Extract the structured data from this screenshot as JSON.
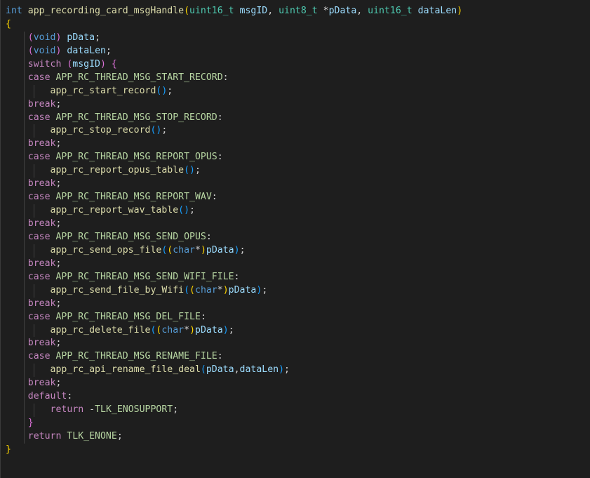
{
  "editor": {
    "language": "c",
    "lines": [
      {
        "indent": 0,
        "tokens": [
          {
            "c": "keyword",
            "t": "int "
          },
          {
            "c": "func",
            "t": "app_recording_card_msgHandle"
          },
          {
            "c": "brace",
            "t": "("
          },
          {
            "c": "type",
            "t": "uint16_t "
          },
          {
            "c": "param",
            "t": "msgID"
          },
          {
            "c": "plain",
            "t": ", "
          },
          {
            "c": "type",
            "t": "uint8_t "
          },
          {
            "c": "plain",
            "t": "*"
          },
          {
            "c": "param",
            "t": "pData"
          },
          {
            "c": "plain",
            "t": ", "
          },
          {
            "c": "type",
            "t": "uint16_t "
          },
          {
            "c": "param",
            "t": "dataLen"
          },
          {
            "c": "brace",
            "t": ")"
          }
        ]
      },
      {
        "indent": 0,
        "tokens": [
          {
            "c": "brace",
            "t": "{"
          }
        ]
      },
      {
        "indent": 1,
        "tokens": [
          {
            "c": "brace2",
            "t": "("
          },
          {
            "c": "keyword",
            "t": "void"
          },
          {
            "c": "brace2",
            "t": ")"
          },
          {
            "c": "plain",
            "t": " "
          },
          {
            "c": "param",
            "t": "pData"
          },
          {
            "c": "plain",
            "t": ";"
          }
        ]
      },
      {
        "indent": 1,
        "tokens": [
          {
            "c": "brace2",
            "t": "("
          },
          {
            "c": "keyword",
            "t": "void"
          },
          {
            "c": "brace2",
            "t": ")"
          },
          {
            "c": "plain",
            "t": " "
          },
          {
            "c": "param",
            "t": "dataLen"
          },
          {
            "c": "plain",
            "t": ";"
          }
        ]
      },
      {
        "indent": 1,
        "tokens": [
          {
            "c": "ctrl",
            "t": "switch "
          },
          {
            "c": "brace2",
            "t": "("
          },
          {
            "c": "param",
            "t": "msgID"
          },
          {
            "c": "brace2",
            "t": ")"
          },
          {
            "c": "plain",
            "t": " "
          },
          {
            "c": "brace2",
            "t": "{"
          }
        ]
      },
      {
        "indent": 1,
        "tokens": [
          {
            "c": "ctrl",
            "t": "case "
          },
          {
            "c": "enumval",
            "t": "APP_RC_THREAD_MSG_START_RECORD"
          },
          {
            "c": "plain",
            "t": ":"
          }
        ]
      },
      {
        "indent": 2,
        "tokens": [
          {
            "c": "func",
            "t": "app_rc_start_record"
          },
          {
            "c": "paren",
            "t": "()"
          },
          {
            "c": "plain",
            "t": ";"
          }
        ]
      },
      {
        "indent": 1,
        "tokens": [
          {
            "c": "ctrl",
            "t": "break"
          },
          {
            "c": "plain",
            "t": ";"
          }
        ]
      },
      {
        "indent": 1,
        "tokens": [
          {
            "c": "ctrl",
            "t": "case "
          },
          {
            "c": "enumval",
            "t": "APP_RC_THREAD_MSG_STOP_RECORD"
          },
          {
            "c": "plain",
            "t": ":"
          }
        ]
      },
      {
        "indent": 2,
        "tokens": [
          {
            "c": "func",
            "t": "app_rc_stop_record"
          },
          {
            "c": "paren",
            "t": "()"
          },
          {
            "c": "plain",
            "t": ";"
          }
        ]
      },
      {
        "indent": 1,
        "tokens": [
          {
            "c": "ctrl",
            "t": "break"
          },
          {
            "c": "plain",
            "t": ";"
          }
        ]
      },
      {
        "indent": 1,
        "tokens": [
          {
            "c": "ctrl",
            "t": "case "
          },
          {
            "c": "enumval",
            "t": "APP_RC_THREAD_MSG_REPORT_OPUS"
          },
          {
            "c": "plain",
            "t": ":"
          }
        ]
      },
      {
        "indent": 2,
        "tokens": [
          {
            "c": "func",
            "t": "app_rc_report_opus_table"
          },
          {
            "c": "paren",
            "t": "()"
          },
          {
            "c": "plain",
            "t": ";"
          }
        ]
      },
      {
        "indent": 1,
        "tokens": [
          {
            "c": "ctrl",
            "t": "break"
          },
          {
            "c": "plain",
            "t": ";"
          }
        ]
      },
      {
        "indent": 1,
        "tokens": [
          {
            "c": "ctrl",
            "t": "case "
          },
          {
            "c": "enumval",
            "t": "APP_RC_THREAD_MSG_REPORT_WAV"
          },
          {
            "c": "plain",
            "t": ":"
          }
        ]
      },
      {
        "indent": 2,
        "tokens": [
          {
            "c": "func",
            "t": "app_rc_report_wav_table"
          },
          {
            "c": "paren",
            "t": "()"
          },
          {
            "c": "plain",
            "t": ";"
          }
        ]
      },
      {
        "indent": 1,
        "tokens": [
          {
            "c": "ctrl",
            "t": "break"
          },
          {
            "c": "plain",
            "t": ";"
          }
        ]
      },
      {
        "indent": 1,
        "tokens": [
          {
            "c": "ctrl",
            "t": "case "
          },
          {
            "c": "enumval",
            "t": "APP_RC_THREAD_MSG_SEND_OPUS"
          },
          {
            "c": "plain",
            "t": ":"
          }
        ]
      },
      {
        "indent": 2,
        "tokens": [
          {
            "c": "func",
            "t": "app_rc_send_ops_file"
          },
          {
            "c": "paren",
            "t": "("
          },
          {
            "c": "brace",
            "t": "("
          },
          {
            "c": "keyword",
            "t": "char"
          },
          {
            "c": "plain",
            "t": "*"
          },
          {
            "c": "brace",
            "t": ")"
          },
          {
            "c": "param",
            "t": "pData"
          },
          {
            "c": "paren",
            "t": ")"
          },
          {
            "c": "plain",
            "t": ";"
          }
        ]
      },
      {
        "indent": 1,
        "tokens": [
          {
            "c": "ctrl",
            "t": "break"
          },
          {
            "c": "plain",
            "t": ";"
          }
        ]
      },
      {
        "indent": 1,
        "tokens": [
          {
            "c": "ctrl",
            "t": "case "
          },
          {
            "c": "enumval",
            "t": "APP_RC_THREAD_MSG_SEND_WIFI_FILE"
          },
          {
            "c": "plain",
            "t": ":"
          }
        ]
      },
      {
        "indent": 2,
        "tokens": [
          {
            "c": "func",
            "t": "app_rc_send_file_by_Wifi"
          },
          {
            "c": "paren",
            "t": "("
          },
          {
            "c": "brace",
            "t": "("
          },
          {
            "c": "keyword",
            "t": "char"
          },
          {
            "c": "plain",
            "t": "*"
          },
          {
            "c": "brace",
            "t": ")"
          },
          {
            "c": "param",
            "t": "pData"
          },
          {
            "c": "paren",
            "t": ")"
          },
          {
            "c": "plain",
            "t": ";"
          }
        ]
      },
      {
        "indent": 1,
        "tokens": [
          {
            "c": "ctrl",
            "t": "break"
          },
          {
            "c": "plain",
            "t": ";"
          }
        ]
      },
      {
        "indent": 1,
        "tokens": [
          {
            "c": "ctrl",
            "t": "case "
          },
          {
            "c": "enumval",
            "t": "APP_RC_THREAD_MSG_DEL_FILE"
          },
          {
            "c": "plain",
            "t": ":"
          }
        ]
      },
      {
        "indent": 2,
        "tokens": [
          {
            "c": "func",
            "t": "app_rc_delete_file"
          },
          {
            "c": "paren",
            "t": "("
          },
          {
            "c": "brace",
            "t": "("
          },
          {
            "c": "keyword",
            "t": "char"
          },
          {
            "c": "plain",
            "t": "*"
          },
          {
            "c": "brace",
            "t": ")"
          },
          {
            "c": "param",
            "t": "pData"
          },
          {
            "c": "paren",
            "t": ")"
          },
          {
            "c": "plain",
            "t": ";"
          }
        ]
      },
      {
        "indent": 1,
        "tokens": [
          {
            "c": "ctrl",
            "t": "break"
          },
          {
            "c": "plain",
            "t": ";"
          }
        ]
      },
      {
        "indent": 1,
        "tokens": [
          {
            "c": "ctrl",
            "t": "case "
          },
          {
            "c": "enumval",
            "t": "APP_RC_THREAD_MSG_RENAME_FILE"
          },
          {
            "c": "plain",
            "t": ":"
          }
        ]
      },
      {
        "indent": 2,
        "tokens": [
          {
            "c": "func",
            "t": "app_rc_api_rename_file_deal"
          },
          {
            "c": "paren",
            "t": "("
          },
          {
            "c": "param",
            "t": "pData"
          },
          {
            "c": "plain",
            "t": ","
          },
          {
            "c": "param",
            "t": "dataLen"
          },
          {
            "c": "paren",
            "t": ")"
          },
          {
            "c": "plain",
            "t": ";"
          }
        ]
      },
      {
        "indent": 1,
        "tokens": [
          {
            "c": "ctrl",
            "t": "break"
          },
          {
            "c": "plain",
            "t": ";"
          }
        ]
      },
      {
        "indent": 1,
        "tokens": [
          {
            "c": "ctrl",
            "t": "default"
          },
          {
            "c": "plain",
            "t": ":"
          }
        ]
      },
      {
        "indent": 2,
        "tokens": [
          {
            "c": "ctrl",
            "t": "return "
          },
          {
            "c": "plain",
            "t": "-"
          },
          {
            "c": "enumval",
            "t": "TLK_ENOSUPPORT"
          },
          {
            "c": "plain",
            "t": ";"
          }
        ]
      },
      {
        "indent": 1,
        "tokens": [
          {
            "c": "brace2",
            "t": "}"
          }
        ]
      },
      {
        "indent": 1,
        "tokens": [
          {
            "c": "ctrl",
            "t": "return "
          },
          {
            "c": "enumval",
            "t": "TLK_ENONE"
          },
          {
            "c": "plain",
            "t": ";"
          }
        ]
      },
      {
        "indent": 0,
        "tokens": [
          {
            "c": "brace",
            "t": "}"
          }
        ]
      }
    ]
  },
  "colors": {
    "background": "#1e1e1e",
    "keyword": "#569cd6",
    "control": "#c586c0",
    "type": "#4ec9b0",
    "function": "#dcdcaa",
    "parameter": "#9cdcfe",
    "enum_member": "#b8d7a3",
    "bracket_level1": "#ffd700",
    "bracket_level2": "#da70d6",
    "bracket_level3": "#179fff"
  }
}
